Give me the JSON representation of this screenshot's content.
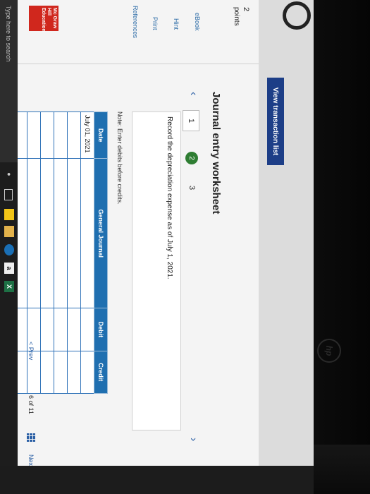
{
  "header": {
    "view_transactions": "View transaction list"
  },
  "side": {
    "points_num": "2",
    "points_label": "points",
    "links": {
      "ebook": "eBook",
      "hint": "Hint",
      "print": "Print",
      "references": "References"
    },
    "logo": "Mc Graw Hill Education"
  },
  "worksheet": {
    "title": "Journal entry worksheet",
    "steps": [
      "1",
      "2",
      "3"
    ],
    "active_step": "2",
    "instruction": "Record the depreciation expense as of July 1, 2021.",
    "note": "Note: Enter debits before credits.",
    "columns": [
      "Date",
      "General Journal",
      "Debit",
      "Credit"
    ],
    "rows": [
      {
        "date": "July 01, 2021",
        "account": "",
        "debit": "",
        "credit": ""
      },
      {
        "date": "",
        "account": "",
        "debit": "",
        "credit": ""
      },
      {
        "date": "",
        "account": "",
        "debit": "",
        "credit": ""
      },
      {
        "date": "",
        "account": "",
        "debit": "",
        "credit": ""
      },
      {
        "date": "",
        "account": "",
        "debit": "",
        "credit": ""
      },
      {
        "date": "",
        "account": "",
        "debit": "",
        "credit": ""
      },
      {
        "date": "",
        "account": "",
        "debit": "",
        "credit": ""
      }
    ]
  },
  "pagination": {
    "prev": "< Prev",
    "count": "6 of 11",
    "next": "Next >"
  },
  "taskbar": {
    "search_placeholder": "Type here to search",
    "app_a": "a",
    "excel": "X"
  }
}
